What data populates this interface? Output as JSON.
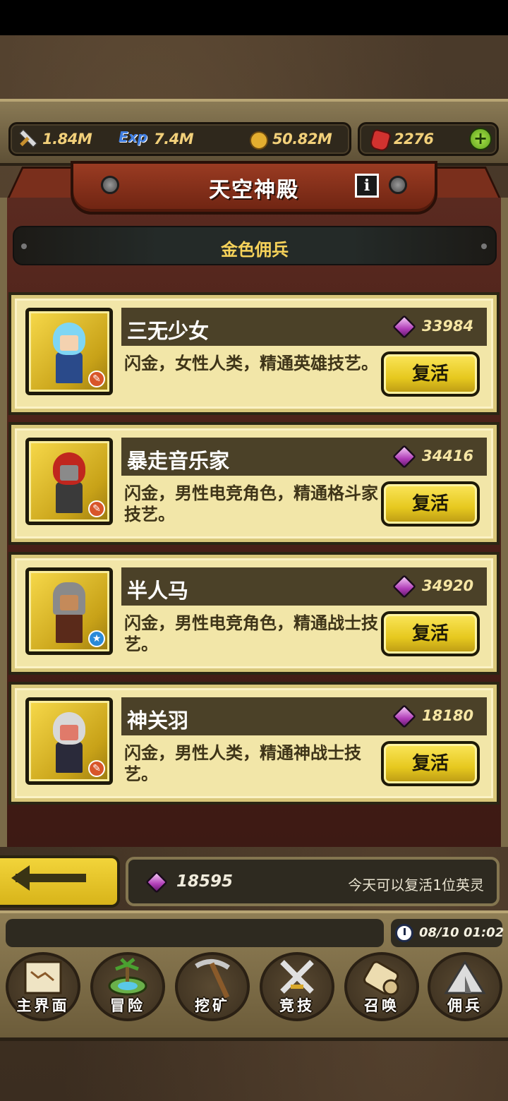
{
  "resources": {
    "attack": "1.84M",
    "exp_label": "Exp",
    "exp": "7.4M",
    "gold": "50.82M",
    "rubies": "2276",
    "add_label": "+"
  },
  "header": {
    "title": "天空神殿",
    "info_label": "i"
  },
  "category": "金色佣兵",
  "heroes": [
    {
      "name": "三无少女",
      "price": "33984",
      "desc": "闪金，女性人类，精通英雄技艺。",
      "button": "复活",
      "badge": "sword-icon"
    },
    {
      "name": "暴走音乐家",
      "price": "34416",
      "desc": "闪金，男性电竞角色，精通格斗家技艺。",
      "button": "复活",
      "badge": "sword-icon"
    },
    {
      "name": "半人马",
      "price": "34920",
      "desc": "闪金，男性电竞角色，精通战士技艺。",
      "button": "复活",
      "badge": "star-icon"
    },
    {
      "name": "神关羽",
      "price": "18180",
      "desc": "闪金，男性人类，精通神战士技艺。",
      "button": "复活",
      "badge": "sword-icon"
    }
  ],
  "footer": {
    "balance": "18595",
    "note": "今天可以复活1位英灵"
  },
  "clock": "08/10 01:02",
  "nav": [
    {
      "label": "主界面",
      "icon": "map-scroll-icon"
    },
    {
      "label": "冒险",
      "icon": "island-icon"
    },
    {
      "label": "挖矿",
      "icon": "pickaxe-icon"
    },
    {
      "label": "竞技",
      "icon": "crossed-swords-icon"
    },
    {
      "label": "召唤",
      "icon": "scroll-icon"
    },
    {
      "label": "佣兵",
      "icon": "tent-icon"
    }
  ],
  "colors": {
    "accent_gold": "#f6d25a",
    "card_bg": "#f2e6a8",
    "ribbon_red": "#9a3b22",
    "gem_purple": "#b23fb9"
  }
}
